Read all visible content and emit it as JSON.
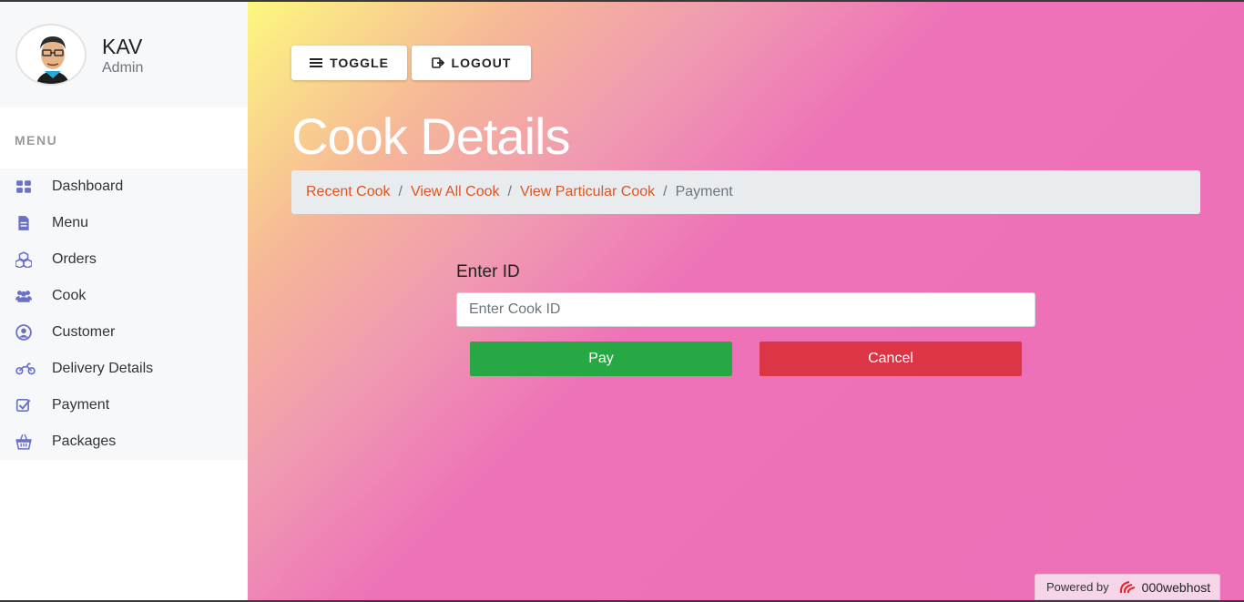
{
  "profile": {
    "name": "KAV",
    "role": "Admin"
  },
  "sidebar": {
    "heading": "MENU",
    "items": [
      {
        "label": "Dashboard",
        "icon": "dashboard-icon"
      },
      {
        "label": "Menu",
        "icon": "document-icon"
      },
      {
        "label": "Orders",
        "icon": "cubes-icon"
      },
      {
        "label": "Cook",
        "icon": "users-icon"
      },
      {
        "label": "Customer",
        "icon": "user-circle-icon"
      },
      {
        "label": "Delivery Details",
        "icon": "motorcycle-icon"
      },
      {
        "label": "Payment",
        "icon": "check-square-icon"
      },
      {
        "label": "Packages",
        "icon": "basket-icon"
      }
    ]
  },
  "toolbar": {
    "toggle_label": "TOGGLE",
    "logout_label": "LOGOUT"
  },
  "page": {
    "title": "Cook Details"
  },
  "breadcrumb": {
    "links": [
      "Recent Cook",
      "View All Cook",
      "View Particular Cook"
    ],
    "separator": "/",
    "active": "Payment"
  },
  "form": {
    "label": "Enter ID",
    "placeholder": "Enter Cook ID",
    "value": "",
    "pay_label": "Pay",
    "cancel_label": "Cancel"
  },
  "footer": {
    "powered_text": "Powered by",
    "brand": "000webhost"
  },
  "colors": {
    "accent": "#6b70c9",
    "link": "#e0541f",
    "pay": "#28a745",
    "cancel": "#dc3545"
  }
}
